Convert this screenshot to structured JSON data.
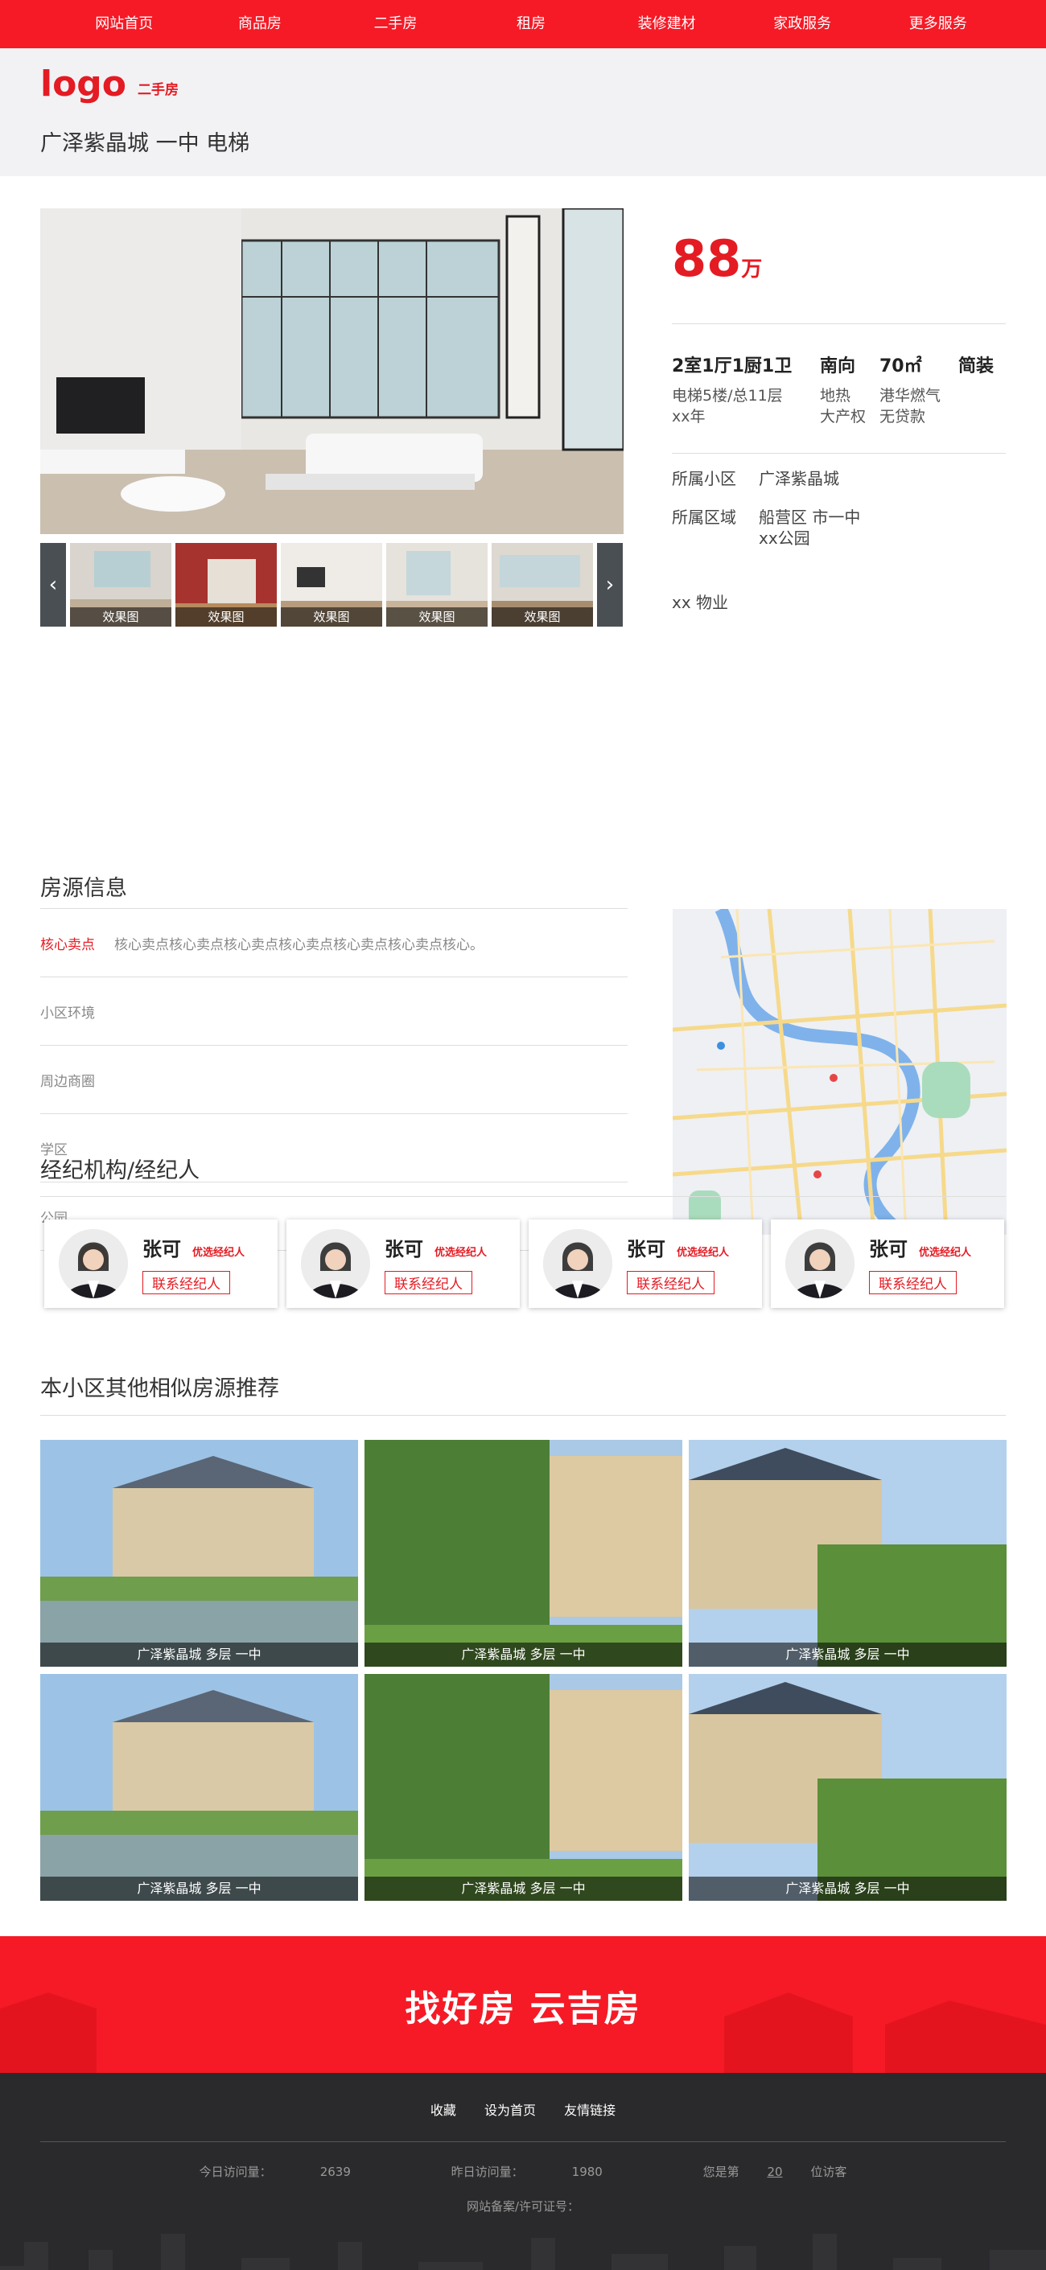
{
  "nav": {
    "items": [
      "网站首页",
      "商品房",
      "二手房",
      "租房",
      "装修建材",
      "家政服务",
      "更多服务"
    ]
  },
  "header": {
    "logo": "logo",
    "logo_sub": "二手房",
    "title": "广泽紫晶城 一中 电梯"
  },
  "gallery": {
    "thumb_caption": "效果图",
    "thumb_count": 5
  },
  "listing": {
    "price": "88",
    "price_unit": "万",
    "specs": [
      {
        "main": "2室1厅1厨1卫",
        "sub1": "电梯5楼/总11层",
        "sub2": "xx年"
      },
      {
        "main": "南向",
        "sub1": "地热",
        "sub2": "大产权"
      },
      {
        "main": "70㎡",
        "sub1": "港华燃气",
        "sub2": "无贷款"
      },
      {
        "main": "简装",
        "sub1": "",
        "sub2": ""
      }
    ],
    "community_label": "所属小区",
    "community": "广泽紫晶城",
    "district_label": "所属区域",
    "district": "船营区 市一中",
    "district2": "xx公园",
    "property": "xx 物业"
  },
  "info": {
    "title": "房源信息",
    "rows": [
      {
        "label": "核心卖点",
        "value": "核心卖点核心卖点核心卖点核心卖点核心卖点核心卖点核心。"
      },
      {
        "label": "小区环境",
        "value": ""
      },
      {
        "label": "周边商圈",
        "value": ""
      },
      {
        "label": "学区",
        "value": ""
      },
      {
        "label": "公园",
        "value": ""
      }
    ]
  },
  "agents": {
    "title": "经纪机构/经纪人",
    "items": [
      {
        "name": "张可",
        "badge": "优选经纪人",
        "button": "联系经纪人"
      },
      {
        "name": "张可",
        "badge": "优选经纪人",
        "button": "联系经纪人"
      },
      {
        "name": "张可",
        "badge": "优选经纪人",
        "button": "联系经纪人"
      },
      {
        "name": "张可",
        "badge": "优选经纪人",
        "button": "联系经纪人"
      }
    ]
  },
  "recommend": {
    "title": "本小区其他相似房源推荐",
    "items": [
      {
        "caption": "广泽紫晶城 多层 一中"
      },
      {
        "caption": "广泽紫晶城 多层 一中"
      },
      {
        "caption": "广泽紫晶城 多层 一中"
      },
      {
        "caption": "广泽紫晶城 多层 一中"
      },
      {
        "caption": "广泽紫晶城 多层 一中"
      },
      {
        "caption": "广泽紫晶城 多层 一中"
      }
    ]
  },
  "slogan": "找好房 云吉房",
  "footer": {
    "links": [
      "收藏",
      "设为首页",
      "友情链接"
    ],
    "today_label": "今日访问量：",
    "today": "2639",
    "yesterday_label": "昨日访问量：",
    "yesterday": "1980",
    "visitor_prefix": "您是第",
    "visitor_num": "20",
    "visitor_suffix": "位访客",
    "licence": "网站备案/许可证号："
  },
  "colors": {
    "accent": "#f51a26",
    "footer_bg": "#2a2a2c"
  }
}
